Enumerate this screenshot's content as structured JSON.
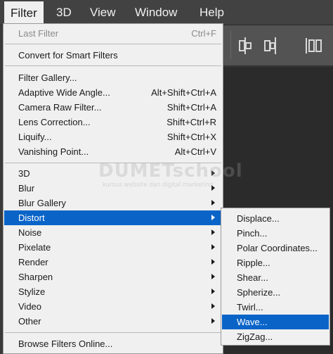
{
  "menubar": {
    "items": [
      {
        "label": "Filter",
        "active": true
      },
      {
        "label": "3D"
      },
      {
        "label": "View"
      },
      {
        "label": "Window"
      },
      {
        "label": "Help"
      }
    ]
  },
  "filter_menu": {
    "last_filter": {
      "label": "Last Filter",
      "shortcut": "Ctrl+F",
      "disabled": true
    },
    "convert_smart": {
      "label": "Convert for Smart Filters"
    },
    "filter_gallery": {
      "label": "Filter Gallery..."
    },
    "adaptive_wide_angle": {
      "label": "Adaptive Wide Angle...",
      "shortcut": "Alt+Shift+Ctrl+A"
    },
    "camera_raw": {
      "label": "Camera Raw Filter...",
      "shortcut": "Shift+Ctrl+A"
    },
    "lens_correction": {
      "label": "Lens Correction...",
      "shortcut": "Shift+Ctrl+R"
    },
    "liquify": {
      "label": "Liquify...",
      "shortcut": "Shift+Ctrl+X"
    },
    "vanishing_point": {
      "label": "Vanishing Point...",
      "shortcut": "Alt+Ctrl+V"
    },
    "submenus": [
      {
        "label": "3D"
      },
      {
        "label": "Blur"
      },
      {
        "label": "Blur Gallery"
      },
      {
        "label": "Distort",
        "highlighted": true
      },
      {
        "label": "Noise"
      },
      {
        "label": "Pixelate"
      },
      {
        "label": "Render"
      },
      {
        "label": "Sharpen"
      },
      {
        "label": "Stylize"
      },
      {
        "label": "Video"
      },
      {
        "label": "Other"
      }
    ],
    "browse_online": {
      "label": "Browse Filters Online..."
    }
  },
  "distort_submenu": {
    "items": [
      {
        "label": "Displace..."
      },
      {
        "label": "Pinch..."
      },
      {
        "label": "Polar Coordinates..."
      },
      {
        "label": "Ripple..."
      },
      {
        "label": "Shear..."
      },
      {
        "label": "Spherize..."
      },
      {
        "label": "Twirl..."
      },
      {
        "label": "Wave...",
        "highlighted": true
      },
      {
        "label": "ZigZag..."
      }
    ]
  },
  "watermark": {
    "brand": "DUMETschool",
    "tagline": "kursus website dan digital marketing"
  },
  "colors": {
    "highlight": "#0a64c8",
    "menu_bg": "#f0f0f0",
    "menubar_bg": "#424242"
  }
}
